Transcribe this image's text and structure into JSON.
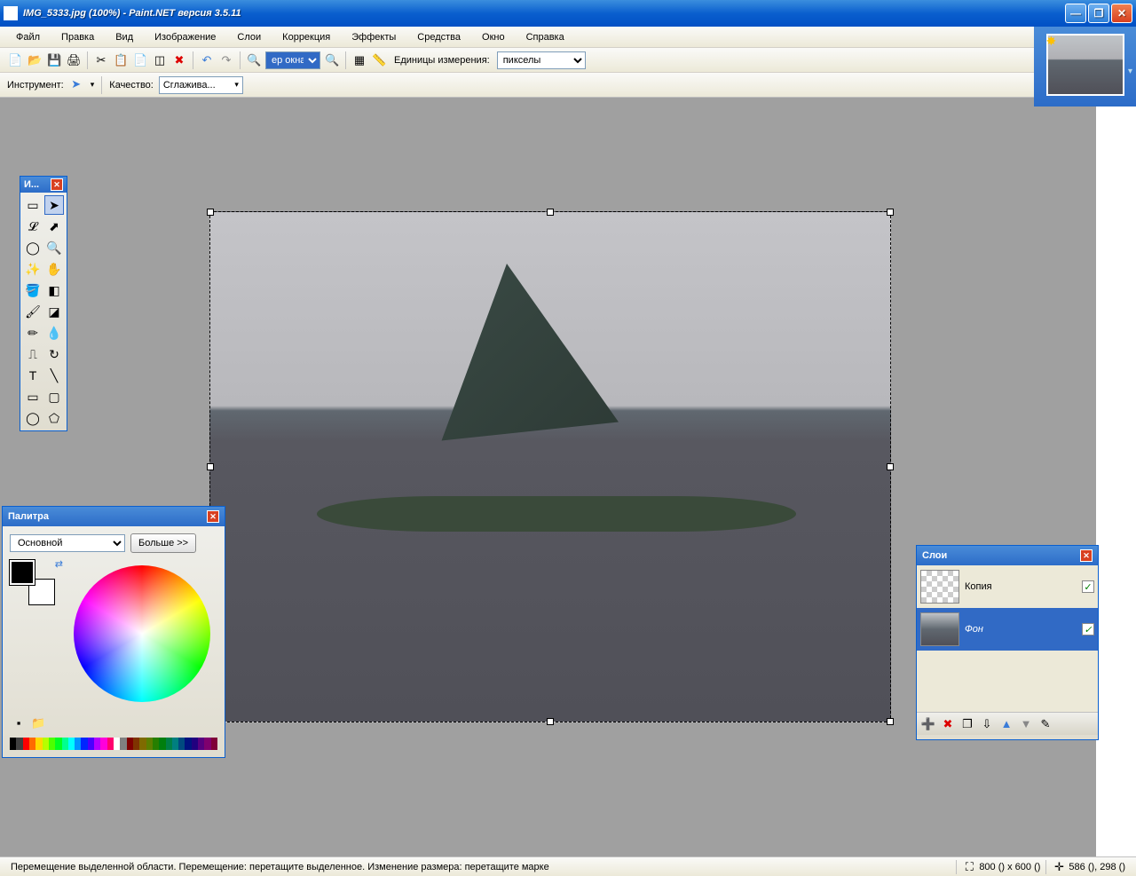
{
  "titlebar": {
    "text": "IMG_5333.jpg (100%) - Paint.NET версия 3.5.11"
  },
  "menu": {
    "file": "Файл",
    "edit": "Правка",
    "view": "Вид",
    "image": "Изображение",
    "layers": "Слои",
    "adjustments": "Коррекция",
    "effects": "Эффекты",
    "tools": "Средства",
    "window": "Окно",
    "help": "Справка"
  },
  "toolbar": {
    "zoom_select_value": "ер окна",
    "units_label": "Единицы измерения:",
    "units_value": "пикселы"
  },
  "tooloptions": {
    "tool_label": "Инструмент:",
    "quality_label": "Качество:",
    "quality_value": "Сглажива..."
  },
  "tools_panel": {
    "title": "И..."
  },
  "palette": {
    "title": "Палитра",
    "mode": "Основной",
    "more": "Больше >>",
    "fg": "#000000",
    "bg": "#ffffff",
    "strip": [
      "#000000",
      "#404040",
      "#ff0000",
      "#ff6a00",
      "#ffd800",
      "#b6ff00",
      "#4cff00",
      "#00ff21",
      "#00ff90",
      "#00ffff",
      "#0094ff",
      "#0026ff",
      "#4800ff",
      "#b200ff",
      "#ff00dc",
      "#ff006e",
      "#ffffff",
      "#808080",
      "#7f0000",
      "#7f3300",
      "#7f6a00",
      "#5b7f00",
      "#267f00",
      "#007f0e",
      "#007f46",
      "#007f7f",
      "#004a7f",
      "#00137f",
      "#21007f",
      "#57007f",
      "#7f006e",
      "#7f0037"
    ]
  },
  "layers": {
    "title": "Слои",
    "items": [
      {
        "name": "Копия",
        "visible": true,
        "active": false
      },
      {
        "name": "Фон",
        "visible": true,
        "active": true
      }
    ]
  },
  "status": {
    "hint": "Перемещение выделенной области. Перемещение: перетащите выделенное. Изменение размера: перетащите марке",
    "size": "800 () x 600 ()",
    "pos": "586 (), 298 ()"
  }
}
